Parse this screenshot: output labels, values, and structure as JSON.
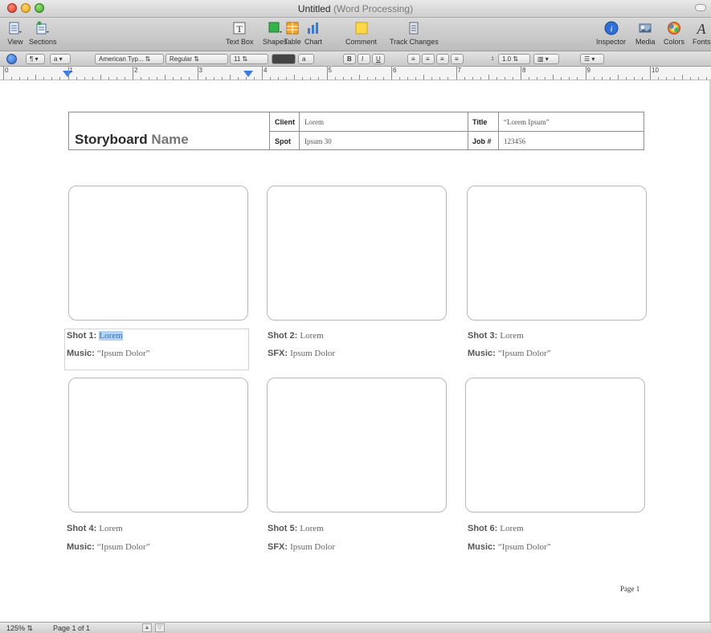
{
  "window": {
    "title": "Untitled",
    "subtitle": "(Word Processing)"
  },
  "toolbar": {
    "left": [
      {
        "label": "View",
        "icon": "view-icon"
      },
      {
        "label": "Sections",
        "icon": "sections-icon"
      }
    ],
    "center": [
      {
        "label": "Text Box",
        "icon": "text-box-icon"
      },
      {
        "label": "Shapes",
        "icon": "shapes-icon"
      },
      {
        "label": "Table",
        "icon": "table-icon"
      },
      {
        "label": "Chart",
        "icon": "chart-icon"
      },
      {
        "label": "Comment",
        "icon": "comment-icon"
      },
      {
        "label": "Track Changes",
        "icon": "track-changes-icon"
      }
    ],
    "right": [
      {
        "label": "Inspector",
        "icon": "inspector-icon"
      },
      {
        "label": "Media",
        "icon": "media-icon"
      },
      {
        "label": "Colors",
        "icon": "colors-icon"
      },
      {
        "label": "Fonts",
        "icon": "fonts-icon"
      }
    ]
  },
  "formatbar": {
    "style1": "¶",
    "style2": "a",
    "font_family": "American Typ...",
    "font_style": "Regular",
    "font_size": "11",
    "char_spacing": "a",
    "bold": "B",
    "italic": "I",
    "underline": "U",
    "line_spacing": "1.0"
  },
  "ruler": {
    "numbers": [
      "0",
      "1",
      "2",
      "3",
      "4",
      "5",
      "6",
      "7",
      "8",
      "9",
      "10"
    ]
  },
  "storyboard": {
    "title_bold": "Storyboard",
    "title_grey": "Name",
    "client_label": "Client",
    "client_value": "Lorem",
    "spot_label": "Spot",
    "spot_value": "Ipsum 30",
    "title_label": "Title",
    "title_value": "“Lorem Ipsum”",
    "job_label": "Job #",
    "job_value": "123456"
  },
  "shots": [
    {
      "shot_label": "Shot 1:",
      "shot_value": "Lorem",
      "meta_label": "Music:",
      "meta_value": "“Ipsum Dolor”"
    },
    {
      "shot_label": "Shot 2:",
      "shot_value": "Lorem",
      "meta_label": "SFX:",
      "meta_value": "Ipsum Dolor"
    },
    {
      "shot_label": "Shot 3:",
      "shot_value": "Lorem",
      "meta_label": "Music:",
      "meta_value": "“Ipsum Dolor”"
    },
    {
      "shot_label": "Shot 4:",
      "shot_value": "Lorem",
      "meta_label": "Music:",
      "meta_value": "“Ipsum Dolor”"
    },
    {
      "shot_label": "Shot 5:",
      "shot_value": "Lorem",
      "meta_label": "SFX:",
      "meta_value": "Ipsum Dolor"
    },
    {
      "shot_label": "Shot 6:",
      "shot_value": "Lorem",
      "meta_label": "Music:",
      "meta_value": "“Ipsum Dolor”"
    }
  ],
  "page_number": "Page 1",
  "statusbar": {
    "zoom": "125%",
    "page_info": "Page 1 of 1"
  }
}
